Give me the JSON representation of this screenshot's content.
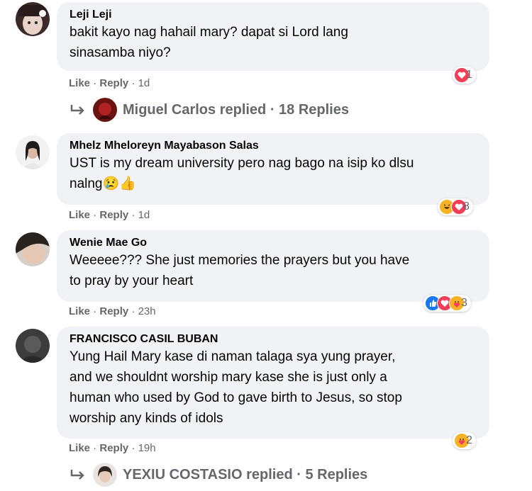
{
  "comments": [
    {
      "author": "Leji Leji",
      "lines": [
        "bakit kayo nag hahail mary? dapat si Lord lang",
        "sinasamba niyo?"
      ],
      "like": "Like",
      "reply": "Reply",
      "time": "1d",
      "reaction_count": "1",
      "reactions": [
        "heart-icon"
      ],
      "replies": {
        "text": "Miguel Carlos replied · 18 Replies"
      }
    },
    {
      "author": "Mhelz Mheloreyn Mayabason Salas",
      "lines": [
        "UST is my dream university pero nag bago na isip ko dlsu",
        "nalng😢👍"
      ],
      "like": "Like",
      "reply": "Reply",
      "time": "1d",
      "reaction_count": "8",
      "reactions": [
        "haha-icon",
        "heart-icon"
      ]
    },
    {
      "author": "Wenie Mae Go",
      "lines": [
        "Weeeee??? She just memories the prayers but you have",
        "to pray by your heart"
      ],
      "like": "Like",
      "reply": "Reply",
      "time": "23h",
      "reaction_count": "3",
      "reactions": [
        "like-icon",
        "heart-icon",
        "care-icon"
      ]
    },
    {
      "author": "FRANCISCO CASIL BUBAN",
      "lines": [
        "Yung Hail Mary kase di naman talaga sya yung prayer,",
        "and we shouldnt worship mary kase she is just only a",
        "human who used by God to gave birth to Jesus, so stop",
        "worship any kinds of idols"
      ],
      "like": "Like",
      "reply": "Reply",
      "time": "19h",
      "reaction_count": "2",
      "reactions": [
        "care-icon"
      ],
      "replies": {
        "text": "YEXIU COSTASIO replied · 5 Replies"
      }
    }
  ],
  "colors": {
    "bubble": "#f0f2f5",
    "meta": "#65676b",
    "heart": "#f33e58",
    "like": "#1877f2",
    "haha": "#f7b125"
  }
}
